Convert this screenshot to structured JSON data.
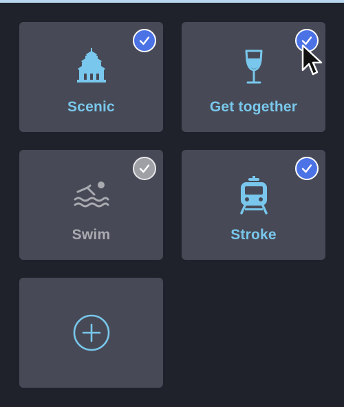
{
  "colors": {
    "background": "#1f222b",
    "tile": "#474a56",
    "accent_text": "#79c7ec",
    "inactive_text": "#a9aab0",
    "check_on": "#4b73e6",
    "check_off": "#9ea0a6"
  },
  "tiles": [
    {
      "label": "Scenic",
      "icon": "pagoda-icon",
      "checked": true
    },
    {
      "label": "Get together",
      "icon": "wine-glass-icon",
      "checked": true
    },
    {
      "label": "Swim",
      "icon": "swimmer-icon",
      "checked": false
    },
    {
      "label": "Stroke",
      "icon": "train-icon",
      "checked": true
    }
  ],
  "add_tile": {
    "icon": "plus-circle-icon"
  }
}
